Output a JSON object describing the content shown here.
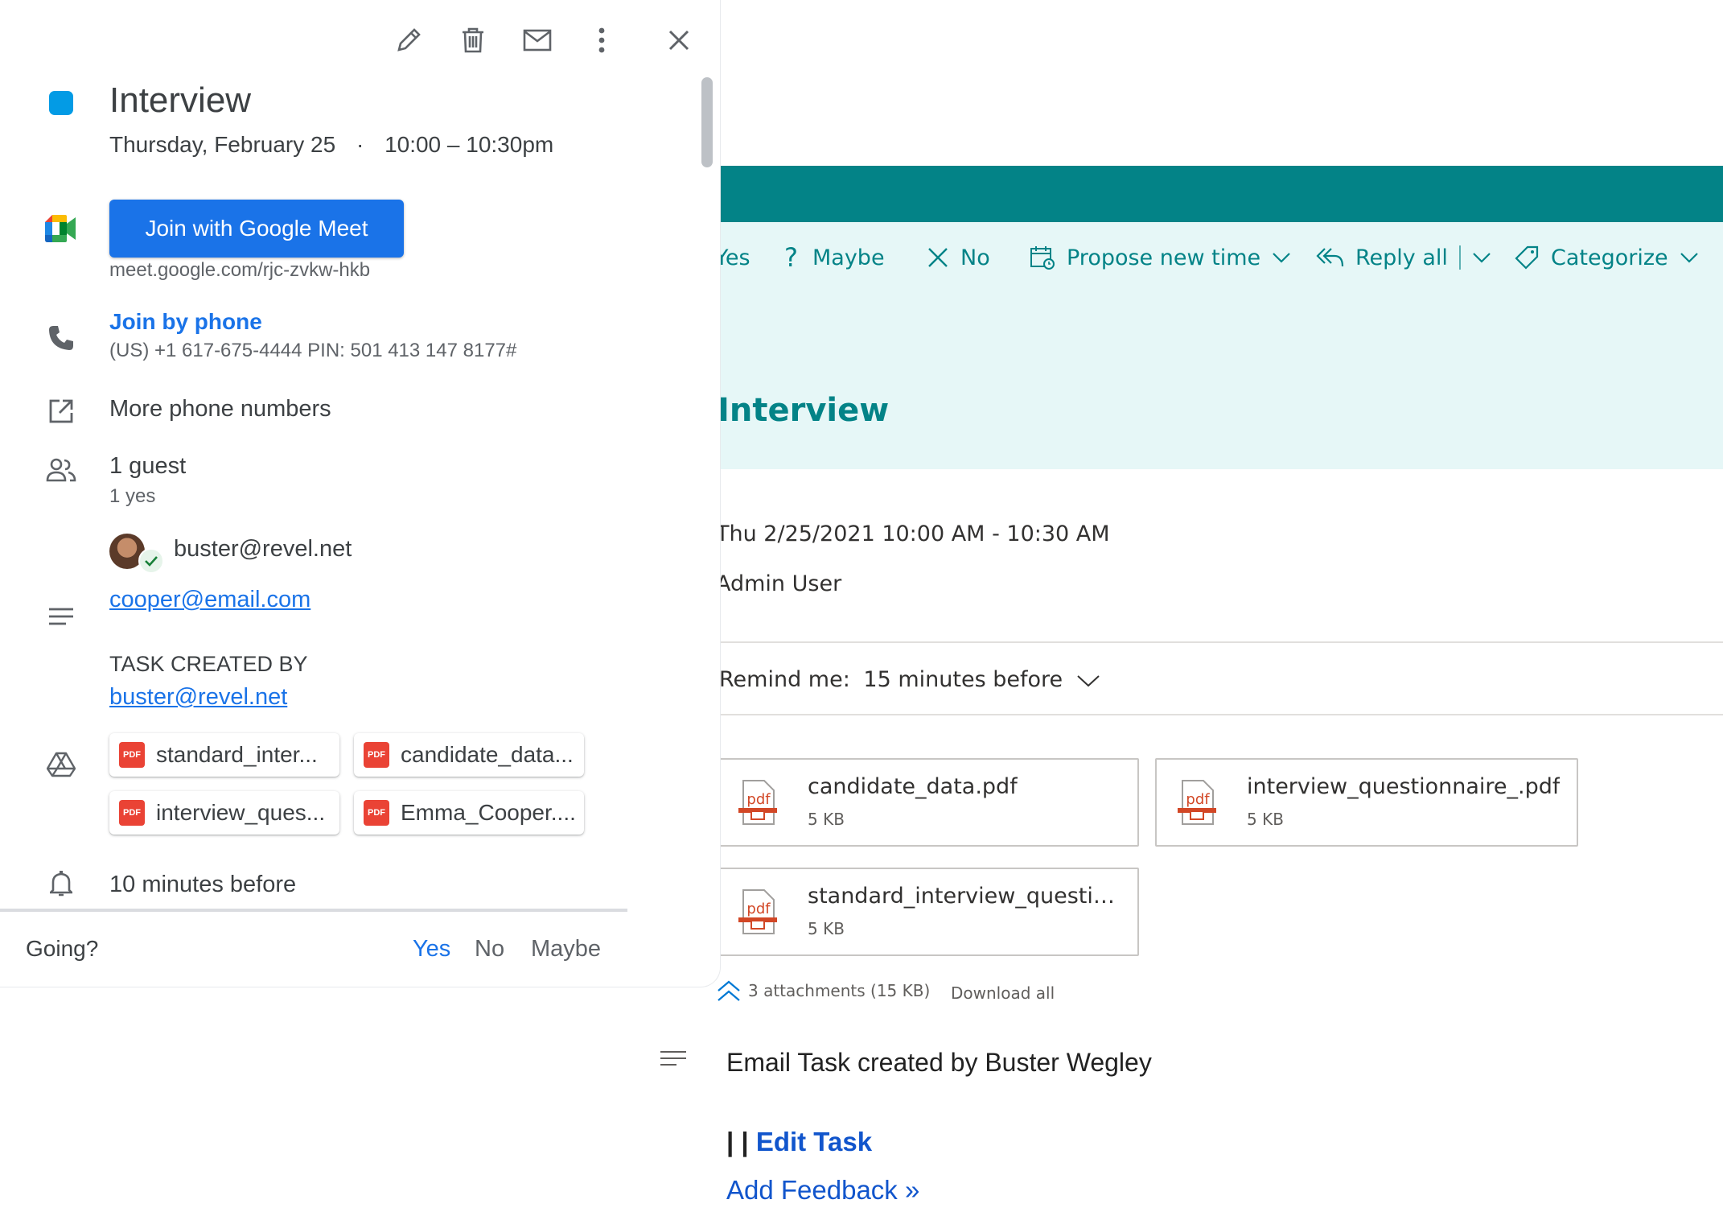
{
  "gcal": {
    "toolbar": {
      "icons": [
        "edit-icon",
        "trash-icon",
        "email-icon",
        "more-vert-icon",
        "close-icon"
      ]
    },
    "event": {
      "title": "Interview",
      "date": "Thursday, February 25",
      "separator": "·",
      "time": "10:00 – 10:30pm",
      "color": "#039be5"
    },
    "meet": {
      "button_label": "Join with Google Meet",
      "link": "meet.google.com/rjc-zvkw-hkb"
    },
    "phone": {
      "label": "Join by phone",
      "details": "(US) +1 617-675-4444 PIN: 501 413 147 8177#"
    },
    "more_phones": "More phone numbers",
    "guests": {
      "count": "1 guest",
      "summary": "1 yes",
      "list": [
        "buster@revel.net"
      ]
    },
    "description": {
      "email": "cooper@email.com",
      "task_label": "TASK CREATED BY",
      "task_by": "buster@revel.net"
    },
    "attachments": [
      {
        "name": "standard_inter...",
        "type": "PDF"
      },
      {
        "name": "candidate_data...",
        "type": "PDF"
      },
      {
        "name": "interview_ques...",
        "type": "PDF"
      },
      {
        "name": "Emma_Cooper....",
        "type": "PDF"
      }
    ],
    "reminder": "10 minutes before",
    "footer": {
      "going": "Going?",
      "yes": "Yes",
      "no": "No",
      "maybe": "Maybe"
    }
  },
  "outlook": {
    "accent": "#038387",
    "actions": {
      "yes": "Yes",
      "maybe": "Maybe",
      "no": "No",
      "propose": "Propose new time",
      "reply_all": "Reply all",
      "categorize": "Categorize"
    },
    "title": "Interview",
    "datetime": "Thu 2/25/2021 10:00 AM - 10:30 AM",
    "calendar": "Admin User",
    "remind": {
      "label": "Remind me:",
      "value": "15 minutes before"
    },
    "attachments": [
      {
        "name": "candidate_data.pdf",
        "size": "5 KB"
      },
      {
        "name": "interview_questionnaire_.pdf",
        "size": "5 KB"
      },
      {
        "name": "standard_interview_questions...",
        "size": "5 KB"
      }
    ],
    "attachments_summary": "3 attachments (15 KB)",
    "download_all": "Download all",
    "body": {
      "text": "Email Task created by Buster Wegley",
      "edit_prefix": "| |",
      "edit_link": "Edit Task",
      "feedback_link": "Add Feedback »"
    }
  }
}
